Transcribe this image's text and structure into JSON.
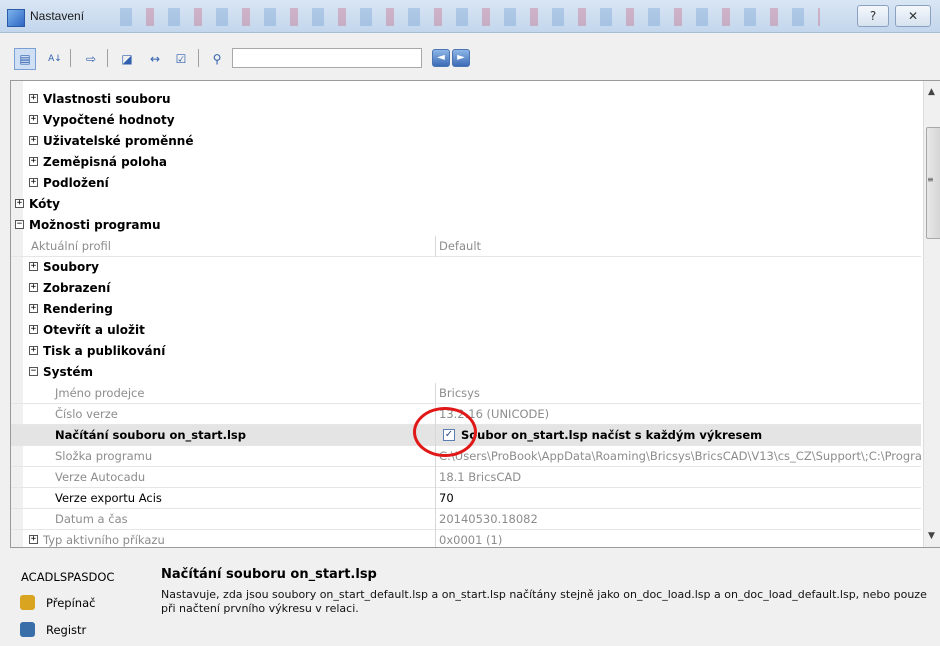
{
  "window": {
    "title": "Nastavení",
    "help_glyph": "?",
    "close_glyph": "✕"
  },
  "toolbar": {
    "search_value": "",
    "prev_glyph": "◄",
    "next_glyph": "►",
    "buttons": [
      {
        "name": "categorized-view",
        "glyph": "▤"
      },
      {
        "name": "alphabetical-view",
        "glyph": "A↓"
      },
      {
        "name": "export",
        "glyph": "⇨"
      },
      {
        "name": "app-settings",
        "glyph": "◪"
      },
      {
        "name": "dimension",
        "glyph": "↔"
      },
      {
        "name": "check",
        "glyph": "☑"
      },
      {
        "name": "binoculars",
        "glyph": "⚲"
      }
    ]
  },
  "grid": {
    "rows": [
      {
        "type": "cat",
        "indent": 1,
        "expander": "+",
        "label": "Vlastnosti souboru"
      },
      {
        "type": "cat",
        "indent": 1,
        "expander": "+",
        "label": "Vypočtené hodnoty"
      },
      {
        "type": "cat",
        "indent": 1,
        "expander": "+",
        "label": "Uživatelské proměnné"
      },
      {
        "type": "cat",
        "indent": 1,
        "expander": "+",
        "label": "Zeměpisná poloha"
      },
      {
        "type": "cat",
        "indent": 1,
        "expander": "+",
        "label": "Podložení"
      },
      {
        "type": "cat",
        "indent": 0,
        "expander": "+",
        "label": "Kóty"
      },
      {
        "type": "cat",
        "indent": 0,
        "expander": "−",
        "label": "Možnosti programu"
      },
      {
        "type": "prop",
        "indent": 1,
        "label": "Aktuální profil",
        "value": "Default"
      },
      {
        "type": "cat",
        "indent": 1,
        "expander": "+",
        "label": "Soubory"
      },
      {
        "type": "cat",
        "indent": 1,
        "expander": "+",
        "label": "Zobrazení"
      },
      {
        "type": "cat",
        "indent": 1,
        "expander": "+",
        "label": "Rendering"
      },
      {
        "type": "cat",
        "indent": 1,
        "expander": "+",
        "label": "Otevřít a uložit"
      },
      {
        "type": "cat",
        "indent": 1,
        "expander": "+",
        "label": "Tisk a publikování"
      },
      {
        "type": "cat",
        "indent": 1,
        "expander": "−",
        "label": "Systém"
      },
      {
        "type": "prop",
        "indent": 2,
        "label": "Jméno prodejce",
        "value": "Bricsys"
      },
      {
        "type": "prop",
        "indent": 2,
        "label": "Číslo verze",
        "value": "13.2.16 (UNICODE)"
      },
      {
        "type": "prop",
        "indent": 2,
        "label": "Načítání souboru on_start.lsp",
        "value": "Soubor on_start.lsp načíst s každým výkresem",
        "checkbox": true,
        "checked": true,
        "selected": true
      },
      {
        "type": "prop",
        "indent": 2,
        "label": "Složka programu",
        "value": "C:\\Users\\ProBook\\AppData\\Roaming\\Bricsys\\BricsCAD\\V13\\cs_CZ\\Support\\;C:\\Program"
      },
      {
        "type": "prop",
        "indent": 2,
        "label": "Verze Autocadu",
        "value": "18.1 BricsCAD"
      },
      {
        "type": "prop",
        "indent": 2,
        "label": "Verze exportu Acis",
        "value": "70",
        "bold": true
      },
      {
        "type": "prop",
        "indent": 2,
        "label": "Datum a čas",
        "value": "20140530.18082"
      },
      {
        "type": "prop",
        "indent": 2,
        "expander": "+",
        "label": "Typ aktivního příkazu",
        "value": "0x0001 (1)"
      }
    ]
  },
  "description": {
    "variable": "ACADLSPASDOC",
    "title": "Načítání souboru on_start.lsp",
    "text": "Nastavuje, zda jsou soubory on_start_default.lsp a on_start.lsp načítány stejně jako on_doc_load.lsp a on_doc_load_default.lsp, nebo pouze při načtení prvního výkresu v relaci.",
    "links": [
      {
        "name": "switch",
        "label": "Přepínač",
        "color": "#d9a520"
      },
      {
        "name": "registry",
        "label": "Registr",
        "color": "#3a6ea8"
      }
    ]
  },
  "colors": {
    "highlight": "#e01818",
    "selected_row": "#e4e4e4"
  }
}
